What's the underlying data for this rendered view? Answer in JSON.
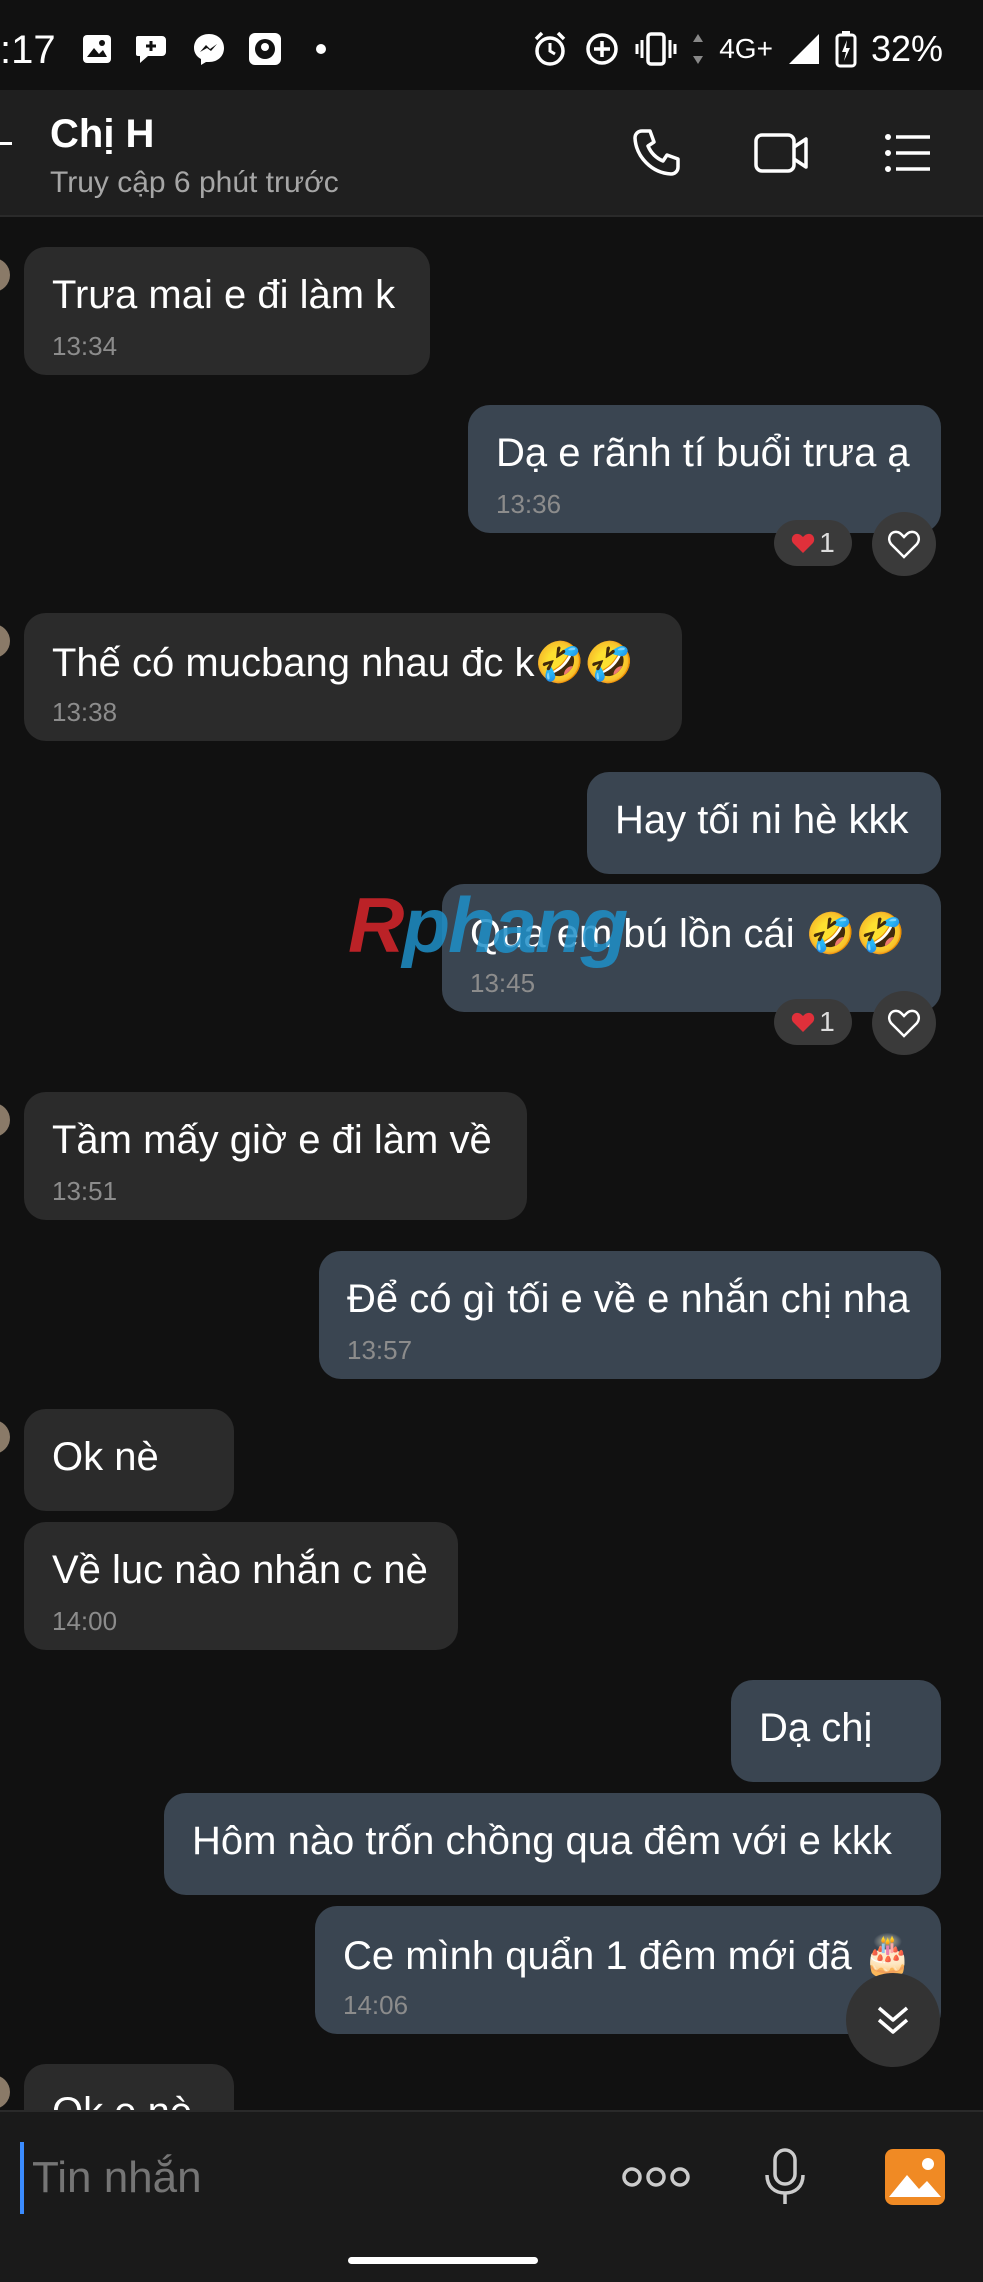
{
  "status_bar": {
    "time": ":17",
    "network": "4G+",
    "battery": "32%"
  },
  "header": {
    "contact_name": "Chị H",
    "last_seen": "Truy cập 6 phút trước"
  },
  "messages": [
    {
      "text": "Trưa mai e đi làm k",
      "time": "13:34"
    },
    {
      "text": "Dạ e rãnh tí buổi trưa ạ",
      "time": "13:36",
      "reaction_count": "1"
    },
    {
      "text": "Thế có mucbang nhau đc k🤣🤣",
      "time": "13:38"
    },
    {
      "text": "Hay tối ni hè kkk"
    },
    {
      "text": "Qua em bú lồn cái 🤣🤣",
      "time": "13:45",
      "reaction_count": "1"
    },
    {
      "text": "Tầm mấy giờ e đi làm về",
      "time": "13:51"
    },
    {
      "text": "Để có gì tối e về e nhắn chị nha",
      "time": "13:57"
    },
    {
      "text": "Ok nè"
    },
    {
      "text": "Về luc nào nhắn c nè",
      "time": "14:00"
    },
    {
      "text": "Dạ chị"
    },
    {
      "text": "Hôm nào trốn chồng qua đêm với e kkk"
    },
    {
      "text": "Ce mình quẩn 1 đêm mới đã 🎂",
      "time": "14:06"
    },
    {
      "text": "Ok e nè"
    }
  ],
  "watermark": {
    "red": "R",
    "blue": "phang"
  },
  "composer": {
    "placeholder": "Tin nhắn"
  },
  "colors": {
    "incoming_bubble": "#2b2b2b",
    "outgoing_bubble": "#3a4551",
    "accent_gallery": "#f08a24",
    "heart": "#e0303a"
  }
}
